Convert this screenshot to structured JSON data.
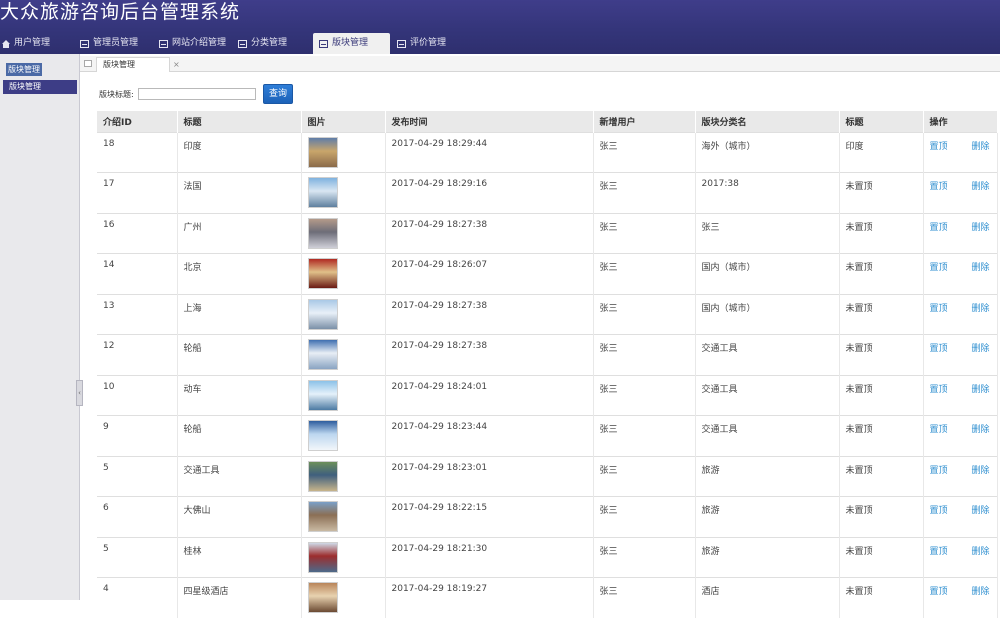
{
  "app": {
    "title": "大众旅游咨询后台管理系统"
  },
  "nav": [
    {
      "label": "用户管理",
      "icon": "home-icon"
    },
    {
      "label": "管理员管理",
      "icon": "list-icon"
    },
    {
      "label": "网站介绍管理",
      "icon": "list-icon"
    },
    {
      "label": "分类管理",
      "icon": "list-icon"
    },
    {
      "label": "版块管理",
      "icon": "list-icon",
      "active": true
    },
    {
      "label": "评价管理",
      "icon": "list-icon"
    }
  ],
  "sidebar": {
    "title": "版块管理",
    "item": "版块管理"
  },
  "tabs": {
    "current": "版块管理",
    "close": "×"
  },
  "search": {
    "label": "版块标题:",
    "value": "",
    "button": "查询"
  },
  "table": {
    "columns": [
      "介绍ID",
      "标题",
      "图片",
      "发布时间",
      "新增用户",
      "版块分类名",
      "标题",
      "操作"
    ],
    "actions": {
      "top": "置顶",
      "delete": "删除"
    },
    "rows": [
      {
        "id": "18",
        "title": "印度",
        "time": "2017-04-29 18:29:44",
        "user": "张三",
        "category": "海外（城市）",
        "status": "印度",
        "img_colors": [
          "#5f7da8",
          "#c9a66b",
          "#8a6a4a"
        ]
      },
      {
        "id": "17",
        "title": "法国",
        "time": "2017-04-29 18:29:16",
        "user": "张三",
        "category": "2017:38",
        "status": "未置顶",
        "img_colors": [
          "#7fb2df",
          "#d9e6f2",
          "#5e7f9e"
        ]
      },
      {
        "id": "16",
        "title": "广州",
        "time": "2017-04-29 18:27:38",
        "user": "张三",
        "category": "张三",
        "status": "未置顶",
        "img_colors": [
          "#b49a8a",
          "#6d6d78",
          "#cfcfd8"
        ]
      },
      {
        "id": "14",
        "title": "北京",
        "time": "2017-04-29 18:26:07",
        "user": "张三",
        "category": "国内（城市）",
        "status": "未置顶",
        "img_colors": [
          "#b02a22",
          "#e0c089",
          "#6a1a14"
        ]
      },
      {
        "id": "13",
        "title": "上海",
        "time": "2017-04-29 18:27:38",
        "user": "张三",
        "category": "国内（城市）",
        "status": "未置顶",
        "img_colors": [
          "#a9c9e6",
          "#e8f0f8",
          "#7b90a8"
        ]
      },
      {
        "id": "12",
        "title": "轮船",
        "time": "2017-04-29 18:27:38",
        "user": "张三",
        "category": "交通工具",
        "status": "未置顶",
        "img_colors": [
          "#3f6fb0",
          "#e8eef5",
          "#8aa4c2"
        ]
      },
      {
        "id": "10",
        "title": "动车",
        "time": "2017-04-29 18:24:01",
        "user": "张三",
        "category": "交通工具",
        "status": "未置顶",
        "img_colors": [
          "#8cc2e8",
          "#e5f1fa",
          "#4c7aa3"
        ]
      },
      {
        "id": "9",
        "title": "轮船",
        "time": "2017-04-29 18:23:44",
        "user": "张三",
        "category": "交通工具",
        "status": "未置顶",
        "img_colors": [
          "#2e5d9e",
          "#bcd6ef",
          "#f2f6fa"
        ]
      },
      {
        "id": "5",
        "title": "交通工具",
        "time": "2017-04-29 18:23:01",
        "user": "张三",
        "category": "旅游",
        "status": "未置顶",
        "img_colors": [
          "#6c8f5a",
          "#3f5f7e",
          "#c7b48a"
        ]
      },
      {
        "id": "6",
        "title": "大佛山",
        "time": "2017-04-29 18:22:15",
        "user": "张三",
        "category": "旅游",
        "status": "未置顶",
        "img_colors": [
          "#7aa0c8",
          "#8b6f55",
          "#c9b9a2"
        ]
      },
      {
        "id": "5",
        "title": "桂林",
        "time": "2017-04-29 18:21:30",
        "user": "张三",
        "category": "旅游",
        "status": "未置顶",
        "img_colors": [
          "#cfd9e6",
          "#9c2d2d",
          "#4d6a8a"
        ]
      },
      {
        "id": "4",
        "title": "四星级酒店",
        "time": "2017-04-29 18:19:27",
        "user": "张三",
        "category": "酒店",
        "status": "未置顶",
        "img_colors": [
          "#b9855a",
          "#e8d2b0",
          "#6b4a32"
        ]
      }
    ]
  }
}
